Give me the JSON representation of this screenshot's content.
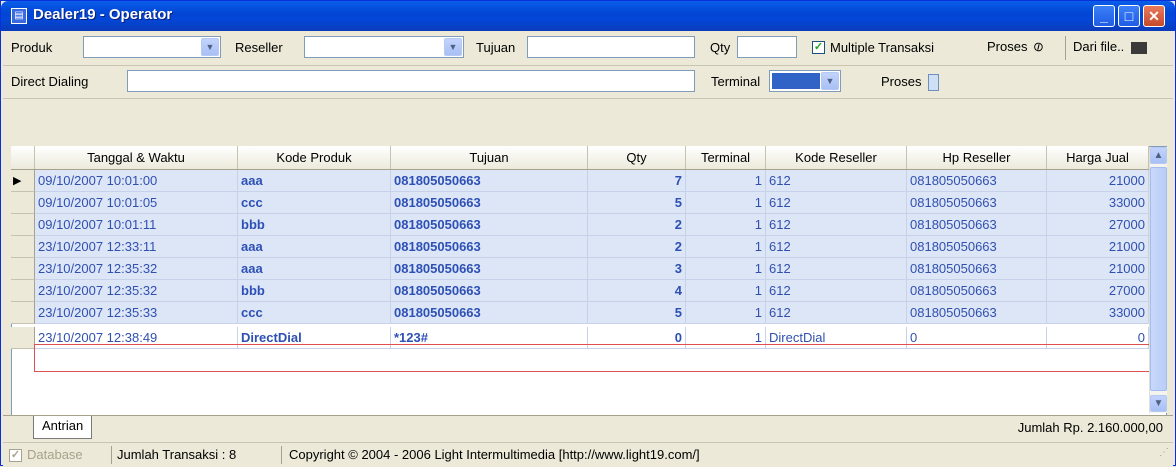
{
  "window": {
    "title": "Dealer19 - Operator",
    "app_icon": "window-icon"
  },
  "toolbar": {
    "produk_label": "Produk",
    "produk_value": "",
    "reseller_label": "Reseller",
    "reseller_value": "",
    "tujuan_label": "Tujuan",
    "tujuan_value": "",
    "qty_label": "Qty",
    "qty_value": "",
    "multiple_label": "Multiple Transaksi",
    "multiple_checked": true,
    "proses_label": "Proses",
    "dari_file_label": "Dari file.."
  },
  "direct": {
    "label": "Direct Dialing",
    "value": "",
    "terminal_label": "Terminal",
    "proses_label": "Proses"
  },
  "table": {
    "columns": [
      "Tanggal & Waktu",
      "Kode Produk",
      "Tujuan",
      "Qty",
      "Terminal",
      "Kode Reseller",
      "Hp Reseller",
      "Harga Jual"
    ],
    "rows": [
      [
        "09/10/2007 10:01:00",
        "aaa",
        "081805050663",
        "7",
        "1",
        "612",
        "081805050663",
        "21000"
      ],
      [
        "09/10/2007 10:01:05",
        "ccc",
        "081805050663",
        "5",
        "1",
        "612",
        "081805050663",
        "33000"
      ],
      [
        "09/10/2007 10:01:11",
        "bbb",
        "081805050663",
        "2",
        "1",
        "612",
        "081805050663",
        "27000"
      ],
      [
        "23/10/2007 12:33:11",
        "aaa",
        "081805050663",
        "2",
        "1",
        "612",
        "081805050663",
        "21000"
      ],
      [
        "23/10/2007 12:35:32",
        "aaa",
        "081805050663",
        "3",
        "1",
        "612",
        "081805050663",
        "21000"
      ],
      [
        "23/10/2007 12:35:32",
        "bbb",
        "081805050663",
        "4",
        "1",
        "612",
        "081805050663",
        "27000"
      ],
      [
        "23/10/2007 12:35:33",
        "ccc",
        "081805050663",
        "5",
        "1",
        "612",
        "081805050663",
        "33000"
      ],
      [
        "23/10/2007 12:38:49",
        "DirectDial",
        "*123#",
        "0",
        "1",
        "DirectDial",
        "0",
        "0"
      ]
    ]
  },
  "tabs": {
    "antrian": "Antrian"
  },
  "summary": {
    "jumlah_rp": "Jumlah Rp. 2.160.000,00"
  },
  "status": {
    "database": "Database",
    "jumlah_transaksi": "Jumlah Transaksi : 8",
    "copyright": "Copyright © 2004 - 2006  Light Intermultimedia [http://www.light19.com/]"
  },
  "colors": {
    "title_blue": "#0a5ee9",
    "row_bg": "#dde6f7",
    "text_blue": "#3050b0",
    "highlight_border": "#e05050"
  }
}
